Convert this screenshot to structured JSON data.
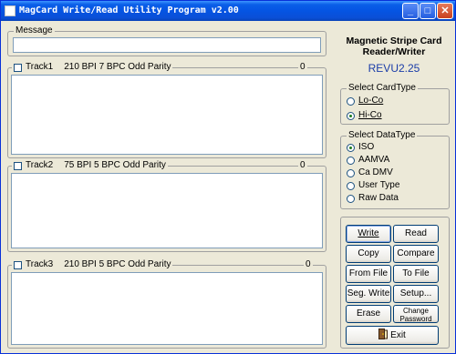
{
  "window": {
    "title": "MagCard Write/Read Utility Program v2.00",
    "minimize": "_",
    "maximize": "□",
    "close": "✕"
  },
  "message": {
    "label": "Message",
    "value": ""
  },
  "tracks": [
    {
      "label": "Track1",
      "settings": "210 BPI  7 BPC  Odd Parity",
      "count": "0",
      "checked": false
    },
    {
      "label": "Track2",
      "settings": "75 BPI  5 BPC  Odd Parity",
      "count": "0",
      "checked": false
    },
    {
      "label": "Track3",
      "settings": "210 BPI  5 BPC  Odd Parity",
      "count": "0",
      "checked": false
    }
  ],
  "device": {
    "name": "Magnetic Stripe Card Reader/Writer",
    "revision": "REVU2.25",
    "revision_color": "#1a3ca8"
  },
  "card_type": {
    "label": "Select CardType",
    "options": [
      "Lo-Co",
      "Hi-Co"
    ],
    "selected": "Hi-Co"
  },
  "data_type": {
    "label": "Select DataType",
    "options": [
      "ISO",
      "AAMVA",
      "Ca DMV",
      "User Type",
      "Raw Data"
    ],
    "selected": "ISO"
  },
  "buttons": {
    "write": "Write",
    "read": "Read",
    "copy": "Copy",
    "compare": "Compare",
    "from_file": "From File",
    "to_file": "To File",
    "seg_write": "Seg. Write",
    "setup": "Setup...",
    "erase": "Erase",
    "change_password": "Change Password",
    "exit": "Exit"
  },
  "colors": {
    "title_bar": "#0554e3",
    "window_bg": "#ece9d8",
    "selected_radio": "#1e7a1e"
  }
}
